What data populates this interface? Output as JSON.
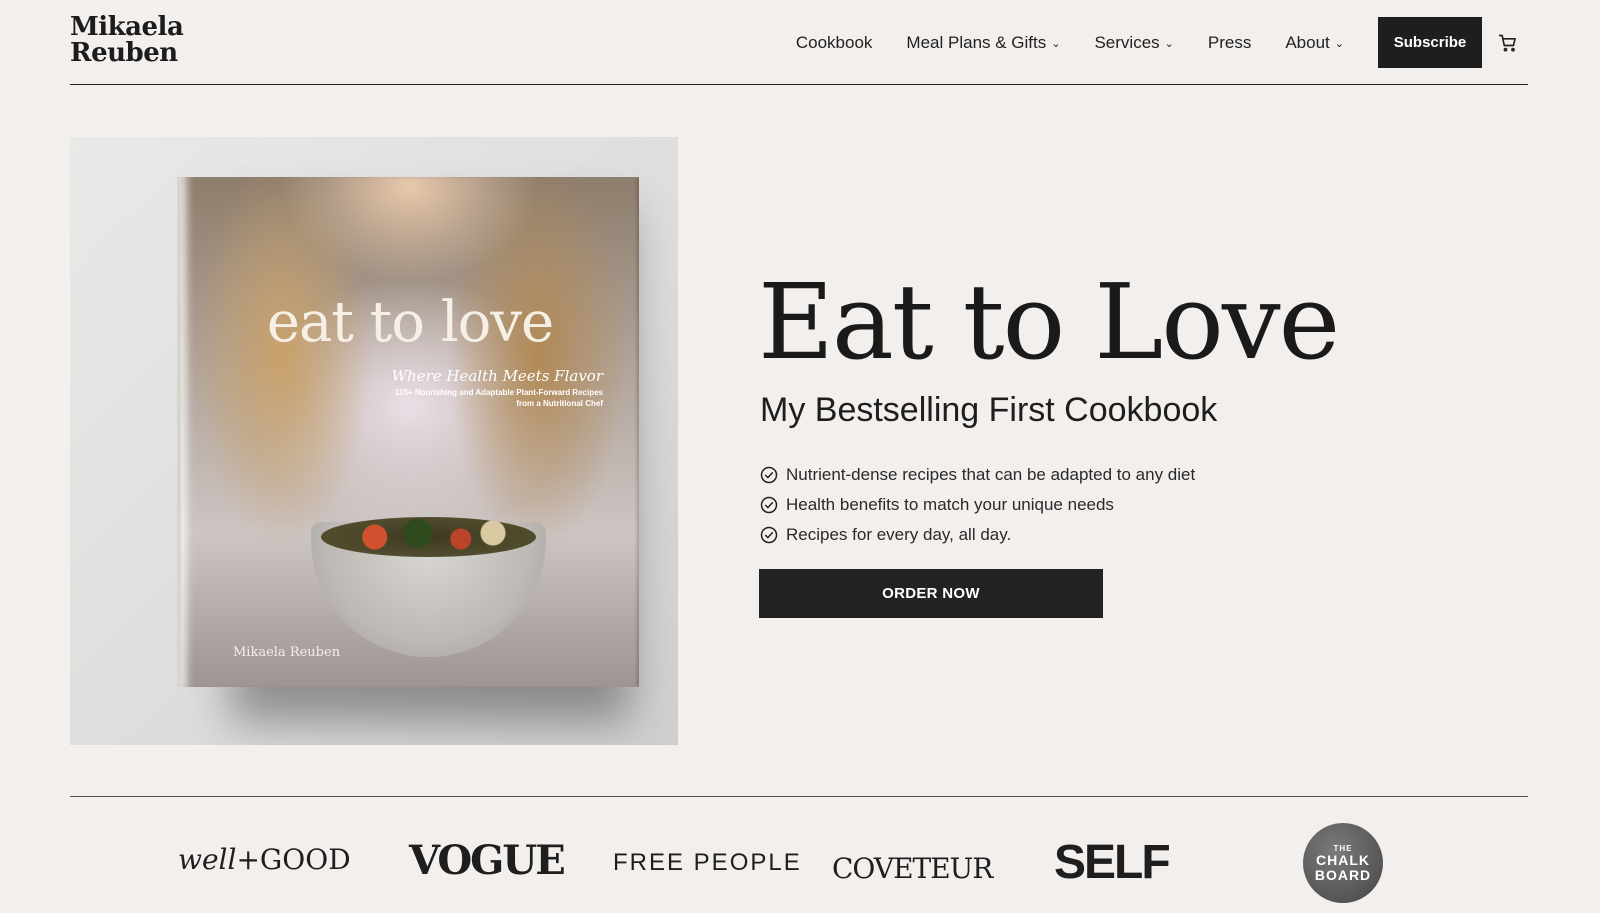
{
  "header": {
    "logo_line1": "Mikaela",
    "logo_line2": "Reuben",
    "nav": [
      {
        "label": "Cookbook"
      },
      {
        "label": "Meal Plans & Gifts"
      },
      {
        "label": "Services"
      },
      {
        "label": "Press"
      },
      {
        "label": "About"
      }
    ],
    "subscribe_label": "Subscribe",
    "cart_icon": "cart-icon"
  },
  "hero": {
    "book_cover": {
      "title": "eat to love",
      "tagline": "Where Health Meets Flavor",
      "subtitle": "115+ Nourishing and Adaptable Plant-Forward Recipes from a Nutritional Chef",
      "author": "Mikaela Reuben"
    },
    "title": "Eat to Love",
    "subtitle": "My Bestselling First Cookbook",
    "features": [
      "Nutrient-dense recipes that can be adapted to any diet",
      "Health benefits to match your unique needs",
      "Recipes for every day, all day."
    ],
    "cta_label": "ORDER NOW"
  },
  "press": {
    "wellgood_a": "well",
    "wellgood_b": "+GOOD",
    "vogue": "VOGUE",
    "free_people": "FREE PEOPLE",
    "coveteur": "COVETEUR",
    "self": "SELF",
    "chalkboard_the": "THE",
    "chalkboard_line1": "CHALK",
    "chalkboard_line2": "BOARD"
  },
  "colors": {
    "background": "#f2efed",
    "dark": "#1e1e1e",
    "button_text": "#ffffff"
  }
}
